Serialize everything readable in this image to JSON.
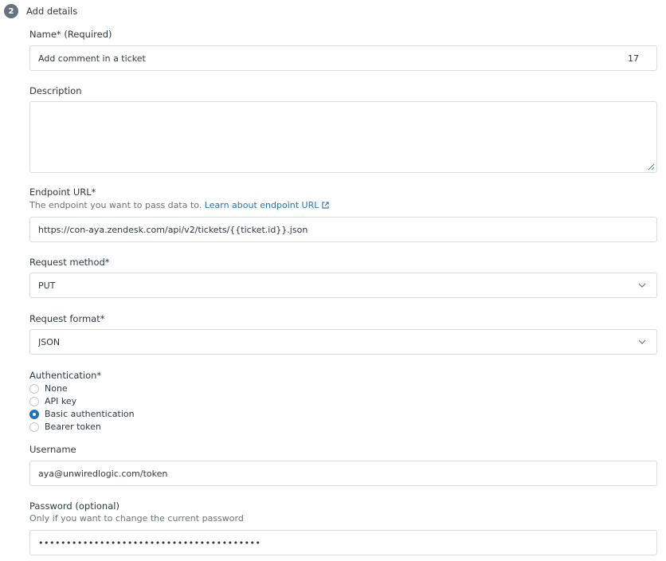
{
  "step": {
    "number": "2",
    "title": "Add details"
  },
  "name": {
    "label": "Name* (Required)",
    "value": "Add comment in a ticket",
    "counter": "17"
  },
  "description": {
    "label": "Description",
    "value": ""
  },
  "endpoint": {
    "label": "Endpoint URL*",
    "hint": "The endpoint you want to pass data to.",
    "link": "Learn about endpoint URL",
    "value": "https://con-aya.zendesk.com/api/v2/tickets/{{ticket.id}}.json"
  },
  "request_method": {
    "label": "Request method*",
    "value": "PUT"
  },
  "request_format": {
    "label": "Request format*",
    "value": "JSON"
  },
  "authentication": {
    "label": "Authentication*",
    "options": [
      "None",
      "API key",
      "Basic authentication",
      "Bearer token"
    ],
    "selected": "Basic authentication"
  },
  "username": {
    "label": "Username",
    "value": "aya@unwiredlogic.com/token"
  },
  "password": {
    "label": "Password (optional)",
    "hint": "Only if you want to change the current password",
    "value": "••••••••••••••••••••••••••••••••••••••••"
  },
  "colors": {
    "accent": "#1f73b7",
    "border": "#d8dcde",
    "badge": "#68737d"
  }
}
